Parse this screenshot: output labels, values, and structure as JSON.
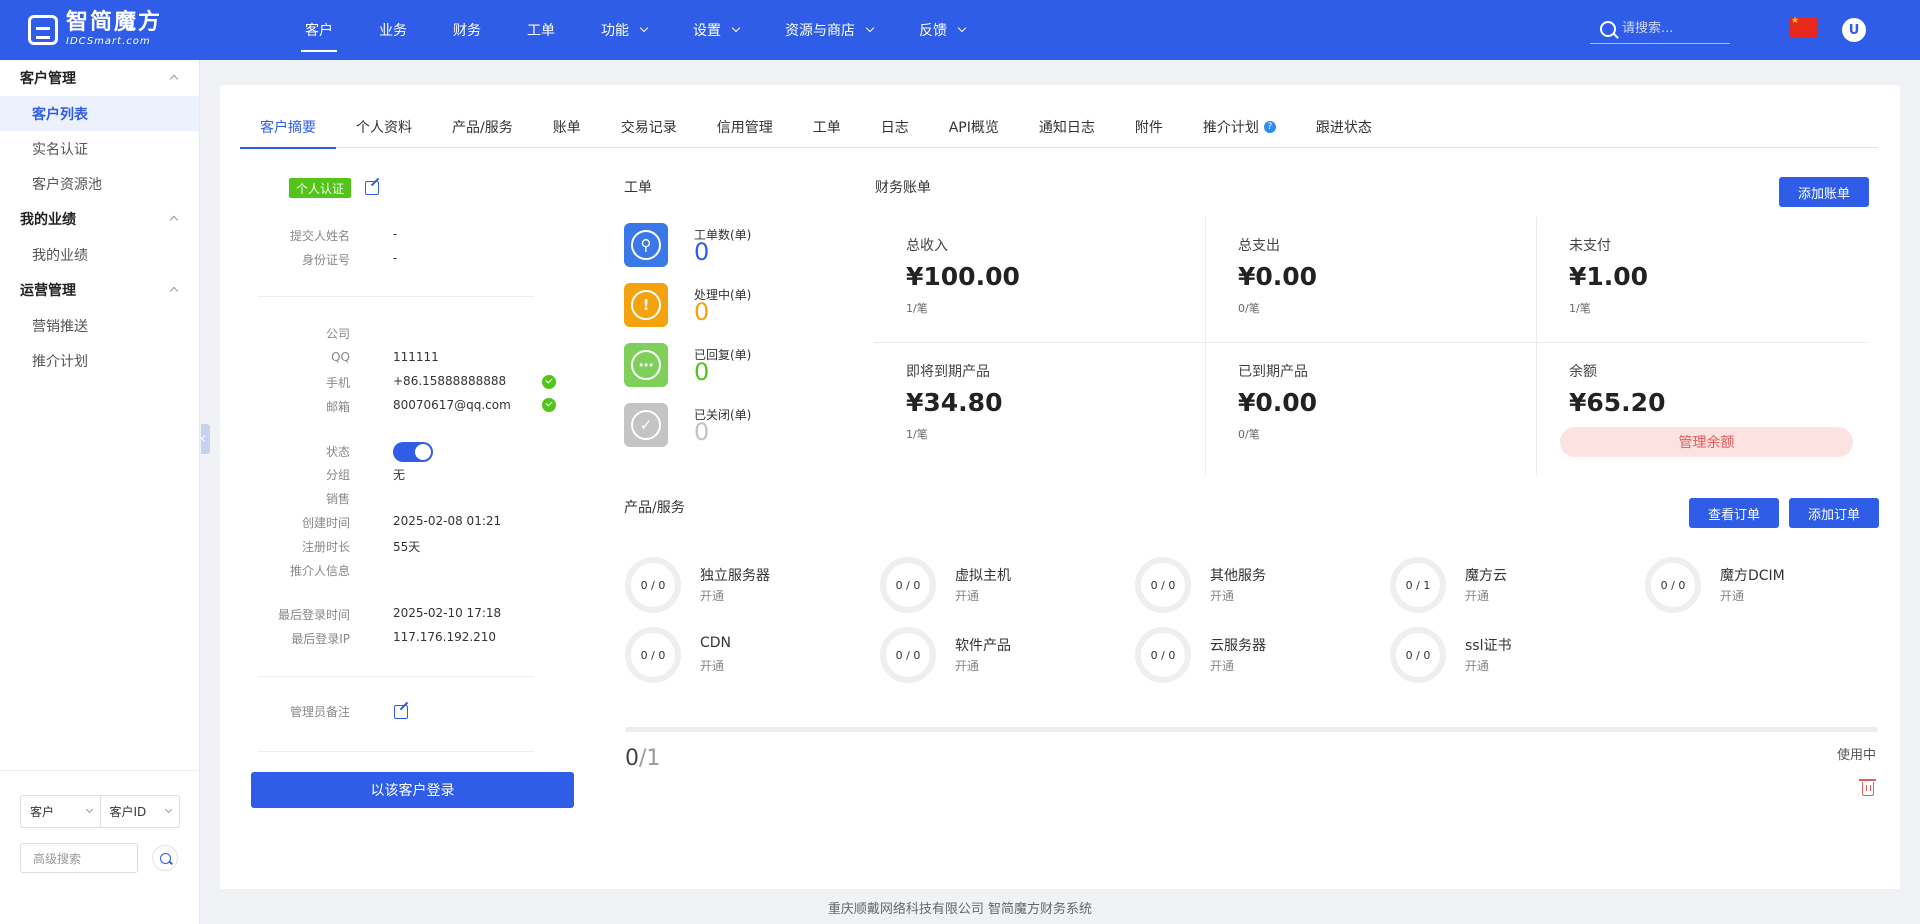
{
  "app": {
    "logo_cn": "智简魔方",
    "logo_en": "IDCSmart.com",
    "accent": "#2f5de8"
  },
  "nav": [
    {
      "label": "客户",
      "active": true,
      "dropdown": false
    },
    {
      "label": "业务",
      "dropdown": false
    },
    {
      "label": "财务",
      "dropdown": false
    },
    {
      "label": "工单",
      "dropdown": false
    },
    {
      "label": "功能",
      "dropdown": true
    },
    {
      "label": "设置",
      "dropdown": true
    },
    {
      "label": "资源与商店",
      "dropdown": true
    },
    {
      "label": "反馈",
      "dropdown": true
    }
  ],
  "search": {
    "placeholder": "请搜索..."
  },
  "user": {
    "avatar_letter": "U"
  },
  "sidebar": {
    "groups": [
      {
        "label": "客户管理",
        "items": [
          "客户列表",
          "实名认证",
          "客户资源池"
        ]
      },
      {
        "label": "我的业绩",
        "items": [
          "我的业绩"
        ]
      },
      {
        "label": "运营管理",
        "items": [
          "营销推送",
          "推介计划"
        ]
      }
    ],
    "active_item": "客户列表",
    "filter": {
      "type": "客户",
      "field": "客户ID",
      "adv_placeholder": "高级搜索"
    }
  },
  "tabs": [
    {
      "label": "客户摘要",
      "active": true
    },
    {
      "label": "个人资料"
    },
    {
      "label": "产品/服务"
    },
    {
      "label": "账单"
    },
    {
      "label": "交易记录"
    },
    {
      "label": "信用管理"
    },
    {
      "label": "工单"
    },
    {
      "label": "日志"
    },
    {
      "label": "API概览"
    },
    {
      "label": "通知日志"
    },
    {
      "label": "附件"
    },
    {
      "label": "推介计划",
      "help": true
    },
    {
      "label": "跟进状态"
    }
  ],
  "customer": {
    "cert_tag": "个人认证",
    "submitter_label": "提交人姓名",
    "submitter_value": "-",
    "idcard_label": "身份证号",
    "idcard_value": "-",
    "company_label": "公司",
    "company_value": "",
    "qq_label": "QQ",
    "qq_value": "111111",
    "phone_label": "手机",
    "phone_value": "+86.15888888888",
    "email_label": "邮箱",
    "email_value": "80070617@qq.com",
    "status_label": "状态",
    "status_on": true,
    "group_label": "分组",
    "group_value": "无",
    "sales_label": "销售",
    "sales_value": "",
    "created_label": "创建时间",
    "created_value": "2025-02-08 01:21",
    "reg_duration_label": "注册时长",
    "reg_duration_value": "55天",
    "referrer_label": "推介人信息",
    "referrer_value": "",
    "last_login_label": "最后登录时间",
    "last_login_value": "2025-02-10 17:18",
    "last_ip_label": "最后登录IP",
    "last_ip_value": "117.176.192.210",
    "admin_note_label": "管理员备注",
    "login_as_button": "以该客户登录"
  },
  "tickets": {
    "title": "工单",
    "items": [
      {
        "label": "工单数(单)",
        "count": "0",
        "color": "#3a78e8",
        "count_color": "#2f5de8",
        "icon": "wrench-icon"
      },
      {
        "label": "处理中(单)",
        "count": "0",
        "color": "#f4a20e",
        "count_color": "#f4a20e",
        "icon": "exclamation-icon"
      },
      {
        "label": "已回复(单)",
        "count": "0",
        "color": "#7ed05a",
        "count_color": "#52c41a",
        "icon": "chat-dots-icon"
      },
      {
        "label": "已关闭(单)",
        "count": "0",
        "color": "#c4c4c4",
        "count_color": "#c4c4c4",
        "icon": "check-circle-icon"
      }
    ]
  },
  "finance": {
    "title": "财务账单",
    "add_bill_button": "添加账单",
    "cells": [
      {
        "label": "总收入",
        "amount": "¥100.00",
        "count": "1/笔"
      },
      {
        "label": "总支出",
        "amount": "¥0.00",
        "count": "0/笔"
      },
      {
        "label": "未支付",
        "amount": "¥1.00",
        "count": "1/笔"
      },
      {
        "label": "即将到期产品",
        "amount": "¥34.80",
        "count": "1/笔"
      },
      {
        "label": "已到期产品",
        "amount": "¥0.00",
        "count": "0/笔"
      },
      {
        "label": "余额",
        "amount": "¥65.20",
        "count": ""
      }
    ],
    "manage_balance_button": "管理余额"
  },
  "products": {
    "title": "产品/服务",
    "view_order_button": "查看订单",
    "add_order_button": "添加订单",
    "items": [
      {
        "ratio": "0 / 0",
        "name": "独立服务器",
        "status": "开通"
      },
      {
        "ratio": "0 / 0",
        "name": "虚拟主机",
        "status": "开通"
      },
      {
        "ratio": "0 / 0",
        "name": "其他服务",
        "status": "开通"
      },
      {
        "ratio": "0 / 1",
        "name": "魔方云",
        "status": "开通"
      },
      {
        "ratio": "0 / 0",
        "name": "魔方DCIM",
        "status": "开通"
      },
      {
        "ratio": "0 / 0",
        "name": "CDN",
        "status": "开通"
      },
      {
        "ratio": "0 / 0",
        "name": "软件产品",
        "status": "开通"
      },
      {
        "ratio": "0 / 0",
        "name": "云服务器",
        "status": "开通"
      },
      {
        "ratio": "0 / 0",
        "name": "ssl证书",
        "status": "开通"
      }
    ],
    "usage_used": "0",
    "usage_total": "/1",
    "usage_fraction": 0,
    "usage_label": "使用中"
  },
  "footer": {
    "text": "重庆顺戴网络科技有限公司 智简魔方财务系统"
  }
}
